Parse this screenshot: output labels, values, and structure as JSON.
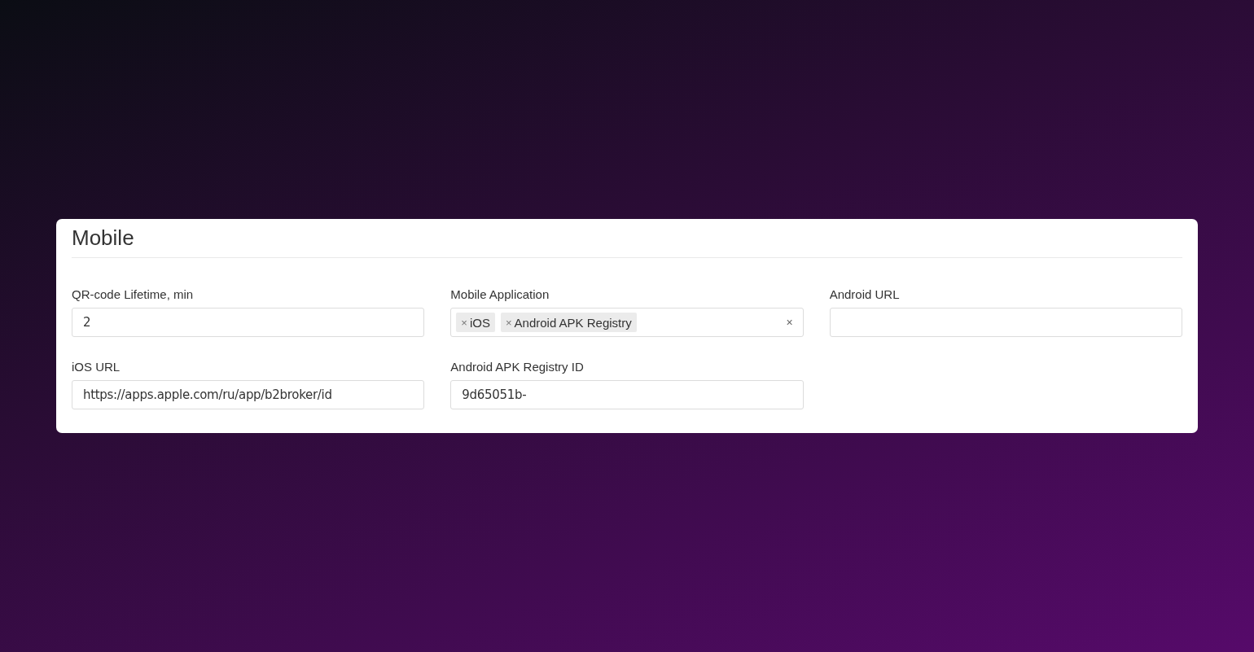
{
  "card": {
    "title": "Mobile"
  },
  "fields": [
    {
      "kind": "text",
      "label": "QR-code Lifetime, min",
      "value": "2"
    },
    {
      "kind": "multiselect",
      "label": "Mobile Application",
      "tags": [
        {
          "remove": "×",
          "label": "iOS"
        },
        {
          "remove": "×",
          "label": "Android APK Registry"
        }
      ],
      "clear": "×"
    },
    {
      "kind": "text",
      "label": "Android URL"
    },
    {
      "kind": "text",
      "label": "iOS URL",
      "value": "https://apps.apple.com/ru/app/b2broker/id"
    },
    {
      "kind": "text",
      "label": "Android APK Registry ID",
      "value": "9d65051b-"
    }
  ]
}
